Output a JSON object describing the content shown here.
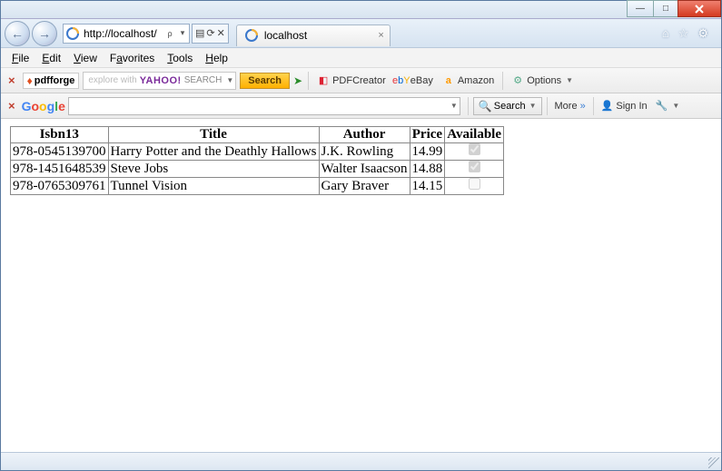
{
  "window": {
    "min_label": "—",
    "max_label": "□"
  },
  "nav": {
    "back_label": "←",
    "fwd_label": "→",
    "url": "http://localhost/",
    "search_placeholder": "ρ",
    "refresh_icons": "⟳",
    "stop_icon": "✕"
  },
  "tab": {
    "title": "localhost"
  },
  "cmd": {
    "home": "⌂",
    "star": "☆",
    "gear": "⚙"
  },
  "menu": {
    "file": "File",
    "edit": "Edit",
    "view": "View",
    "favorites": "Favorites",
    "tools": "Tools",
    "help": "Help"
  },
  "tb1": {
    "pdfforge": "pdfforge",
    "yahoo_placeholder": "explore with",
    "yahoo_logo": "YAHOO!",
    "yahoo_search": "SEARCH",
    "search_btn": "Search",
    "pdfcreator": "PDFCreator",
    "ebay": "eBay",
    "amazon": "Amazon",
    "options": "Options"
  },
  "tb2": {
    "google": "Google",
    "search": "Search",
    "more": "More",
    "signin": "Sign In"
  },
  "table": {
    "headers": {
      "isbn": "Isbn13",
      "title": "Title",
      "author": "Author",
      "price": "Price",
      "available": "Available"
    },
    "rows": [
      {
        "isbn": "978-0545139700",
        "title": "Harry Potter and the Deathly Hallows",
        "author": "J.K. Rowling",
        "price": "14.99",
        "available": true
      },
      {
        "isbn": "978-1451648539",
        "title": "Steve Jobs",
        "author": "Walter Isaacson",
        "price": "14.88",
        "available": true
      },
      {
        "isbn": "978-0765309761",
        "title": "Tunnel Vision",
        "author": "Gary Braver",
        "price": "14.15",
        "available": false
      }
    ]
  }
}
